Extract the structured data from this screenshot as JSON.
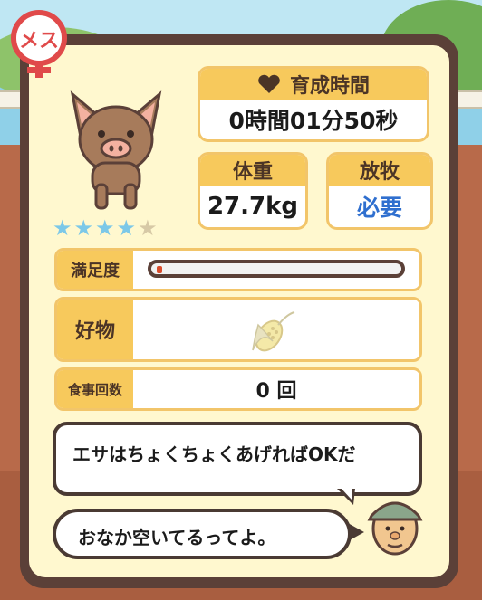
{
  "gender": {
    "label": "メス"
  },
  "pig": {
    "rating_stars_filled": 4,
    "rating_stars_total": 5
  },
  "growth_time": {
    "label": "育成時間",
    "value": "0時間01分50秒"
  },
  "weight": {
    "label": "体重",
    "value": "27.7kg"
  },
  "pasture": {
    "label": "放牧",
    "value": "必要"
  },
  "satisfaction": {
    "label": "満足度",
    "level_fraction": 0.02,
    "fill_color": "#d94b2b"
  },
  "favorite_food": {
    "label": "好物",
    "icon": "corn-icon"
  },
  "meal_count": {
    "label": "食事回数",
    "value": "0 回"
  },
  "dialogue": {
    "advice": "エサはちょくちょくあげればOKだ",
    "status": "おなか空いてるってよ。"
  },
  "colors": {
    "panel_border": "#5b4038",
    "panel_bg": "#fff8cf",
    "header_yellow": "#f7c95c",
    "star_blue": "#7cc8e8",
    "accent_blue": "#2f6fcf",
    "gender_red": "#e04a4a"
  }
}
